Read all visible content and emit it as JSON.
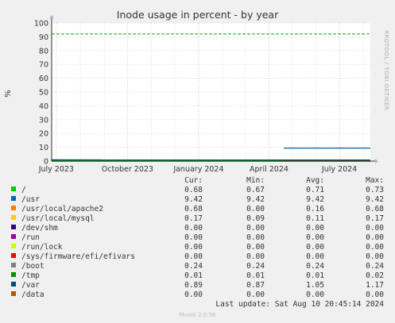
{
  "chart_data": {
    "type": "line",
    "title": "Inode usage in percent - by year",
    "ylabel": "%",
    "side_label": "RRDTOOL / TOBI OETIKER",
    "ylim": [
      0,
      100
    ],
    "y_ticks": [
      0,
      10,
      20,
      30,
      40,
      50,
      60,
      70,
      80,
      90,
      100
    ],
    "x_start": "2023-06-25",
    "x_end": "2024-08-10",
    "x_ticks": [
      {
        "date": "2023-07-01",
        "label": "July 2023"
      },
      {
        "date": "2023-10-01",
        "label": "October 2023"
      },
      {
        "date": "2024-01-01",
        "label": "January 2024"
      },
      {
        "date": "2024-04-01",
        "label": "April 2024"
      },
      {
        "date": "2024-07-01",
        "label": "July 2024"
      }
    ],
    "grid": true,
    "warning_line": {
      "value": 92,
      "color": "#00aa00"
    },
    "columns": [
      "Cur:",
      "Min:",
      "Avg:",
      "Max:"
    ],
    "series": [
      {
        "name": "/",
        "color": "#00cc00",
        "cur": "0.68",
        "min": "0.67",
        "avg": "0.71",
        "max": "0.73",
        "line": [
          [
            "2023-06-25",
            0.7
          ],
          [
            "2024-08-10",
            0.68
          ]
        ]
      },
      {
        "name": "/usr",
        "color": "#0066b3",
        "cur": "9.42",
        "min": "9.42",
        "avg": "9.42",
        "max": "9.42",
        "line": [
          [
            "2024-04-20",
            9.42
          ],
          [
            "2024-08-10",
            9.42
          ]
        ]
      },
      {
        "name": "/usr/local/apache2",
        "color": "#ff8000",
        "cur": "0.68",
        "min": "0.00",
        "avg": "0.16",
        "max": "0.68",
        "line": [
          [
            "2024-04-20",
            0.68
          ],
          [
            "2024-08-10",
            0.68
          ]
        ]
      },
      {
        "name": "/usr/local/mysql",
        "color": "#ffcc00",
        "cur": "0.17",
        "min": "0.09",
        "avg": "0.11",
        "max": "0.17",
        "line": [
          [
            "2024-04-20",
            0.17
          ],
          [
            "2024-08-10",
            0.17
          ]
        ]
      },
      {
        "name": "/dev/shm",
        "color": "#330099",
        "cur": "0.00",
        "min": "0.00",
        "avg": "0.00",
        "max": "0.00",
        "line": []
      },
      {
        "name": "/run",
        "color": "#990099",
        "cur": "0.00",
        "min": "0.00",
        "avg": "0.00",
        "max": "0.00",
        "line": []
      },
      {
        "name": "/run/lock",
        "color": "#ccff00",
        "cur": "0.00",
        "min": "0.00",
        "avg": "0.00",
        "max": "0.00",
        "line": []
      },
      {
        "name": "/sys/firmware/efi/efivars",
        "color": "#ff0000",
        "cur": "0.00",
        "min": "0.00",
        "avg": "0.00",
        "max": "0.00",
        "line": []
      },
      {
        "name": "/boot",
        "color": "#808080",
        "cur": "0.24",
        "min": "0.24",
        "avg": "0.24",
        "max": "0.24",
        "line": [
          [
            "2024-04-20",
            0.24
          ],
          [
            "2024-08-10",
            0.24
          ]
        ]
      },
      {
        "name": "/tmp",
        "color": "#008f00",
        "cur": "0.01",
        "min": "0.01",
        "avg": "0.01",
        "max": "0.02",
        "line": [
          [
            "2023-06-25",
            0.01
          ],
          [
            "2024-08-10",
            0.01
          ]
        ]
      },
      {
        "name": "/var",
        "color": "#00487d",
        "cur": "0.89",
        "min": "0.87",
        "avg": "1.05",
        "max": "1.17",
        "line": [
          [
            "2023-06-25",
            0.9
          ],
          [
            "2024-08-10",
            0.89
          ]
        ]
      },
      {
        "name": "/data",
        "color": "#b35a00",
        "cur": "0.00",
        "min": "0.00",
        "avg": "0.00",
        "max": "0.00",
        "line": [
          [
            "2024-04-20",
            0.0
          ],
          [
            "2024-08-10",
            0.0
          ]
        ]
      }
    ]
  },
  "footer": {
    "last_update": "Last update: Sat Aug 10 20:45:14 2024",
    "version": "Munin 2.0.56"
  }
}
